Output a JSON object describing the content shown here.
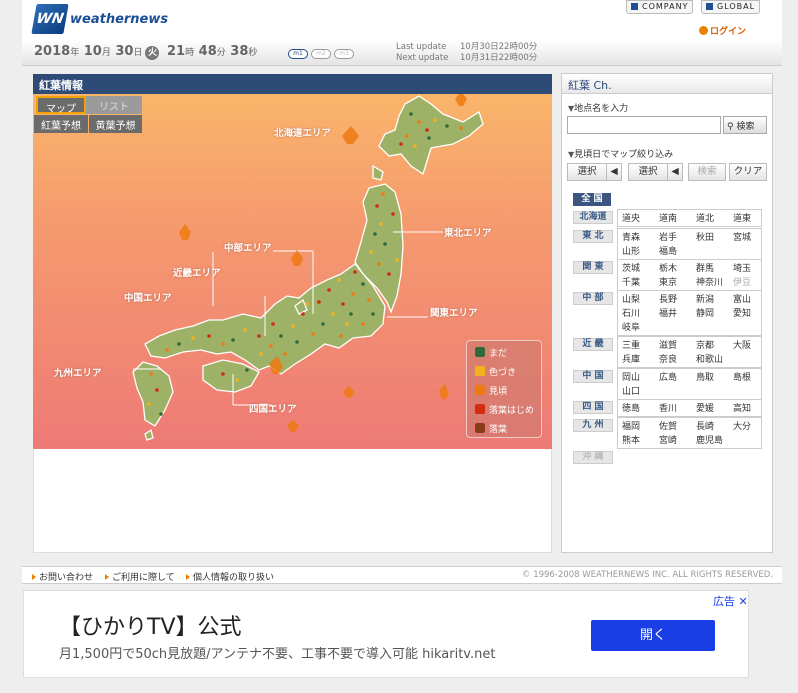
{
  "header": {
    "logo_mark": "WN",
    "logo_text": "weathernews",
    "company_label": "COMPANY",
    "global_label": "GLOBAL",
    "login_label": "ログイン"
  },
  "datebar": {
    "year": "2018",
    "year_unit": "年",
    "month": "10",
    "month_unit": "月",
    "day": "30",
    "day_unit": "日",
    "weekday": "火",
    "hour": "21",
    "hour_unit": "時",
    "minute": "48",
    "minute_unit": "分",
    "second": "38",
    "second_unit": "秒",
    "mode_buttons": [
      "m1",
      "m2",
      "m3"
    ],
    "last_update_label": "Last update",
    "last_update_value": "10月30日22時00分",
    "next_update_label": "Next update",
    "next_update_value": "10月31日22時00分"
  },
  "map_panel": {
    "title": "紅葉情報",
    "tab_map": "マップ",
    "tab_list": "リスト",
    "tab_koyo": "紅葉予想",
    "tab_oyo": "黄葉予想",
    "areas": {
      "hokkaido": "北海道エリア",
      "tohoku": "東北エリア",
      "chubu": "中部エリア",
      "kinki": "近畿エリア",
      "chugoku": "中国エリア",
      "kanto": "関東エリア",
      "kyushu": "九州エリア",
      "shikoku": "四国エリア"
    },
    "legend": [
      {
        "label": "まだ",
        "color": "#2f6b3a"
      },
      {
        "label": "色づき",
        "color": "#f3b21b"
      },
      {
        "label": "見頃",
        "color": "#ee7a12"
      },
      {
        "label": "落葉はじめ",
        "color": "#d42a10"
      },
      {
        "label": "落葉",
        "color": "#8a3a18"
      }
    ]
  },
  "side_panel": {
    "title": "紅葉 Ch.",
    "search_label": "地点名を入力",
    "search_placeholder": "",
    "search_button": "検索",
    "filter_label": "見頃日でマップ絞り込み",
    "select1": "選択",
    "select2": "選択",
    "filter_search": "検索",
    "clear": "クリア",
    "all_label": "全 国",
    "regions": [
      {
        "name": "北海道",
        "prefs": [
          "道央",
          "道南",
          "道北",
          "道東"
        ]
      },
      {
        "name": "東 北",
        "prefs": [
          "青森",
          "岩手",
          "秋田",
          "宮城",
          "山形",
          "福島"
        ]
      },
      {
        "name": "関 東",
        "prefs": [
          "茨城",
          "栃木",
          "群馬",
          "埼玉",
          "千葉",
          "東京",
          "神奈川",
          "伊豆"
        ]
      },
      {
        "name": "中 部",
        "prefs": [
          "山梨",
          "長野",
          "新潟",
          "富山",
          "石川",
          "福井",
          "静岡",
          "愛知",
          "岐阜"
        ]
      },
      {
        "name": "近 畿",
        "prefs": [
          "三重",
          "滋賀",
          "京都",
          "大阪",
          "兵庫",
          "奈良",
          "和歌山"
        ]
      },
      {
        "name": "中 国",
        "prefs": [
          "岡山",
          "広島",
          "鳥取",
          "島根",
          "山口"
        ]
      },
      {
        "name": "四 国",
        "prefs": [
          "徳島",
          "香川",
          "愛媛",
          "高知"
        ]
      },
      {
        "name": "九 州",
        "prefs": [
          "福岡",
          "佐賀",
          "長崎",
          "大分",
          "熊本",
          "宮崎",
          "鹿児島"
        ]
      },
      {
        "name": "沖 縄",
        "prefs": []
      }
    ]
  },
  "footer": {
    "contact": "お問い合わせ",
    "terms": "ご利用に際して",
    "privacy": "個人情報の取り扱い",
    "copyright": "1996-2008 WEATHERNEWS INC. ALL RIGHTS RESERVED."
  },
  "ad": {
    "tag": "広告",
    "title": "【ひかりTV】公式",
    "subtitle": "月1,500円で50ch見放題/アンテナ不要、工事不要で導入可能 hikaritv.net",
    "button": "開く"
  }
}
